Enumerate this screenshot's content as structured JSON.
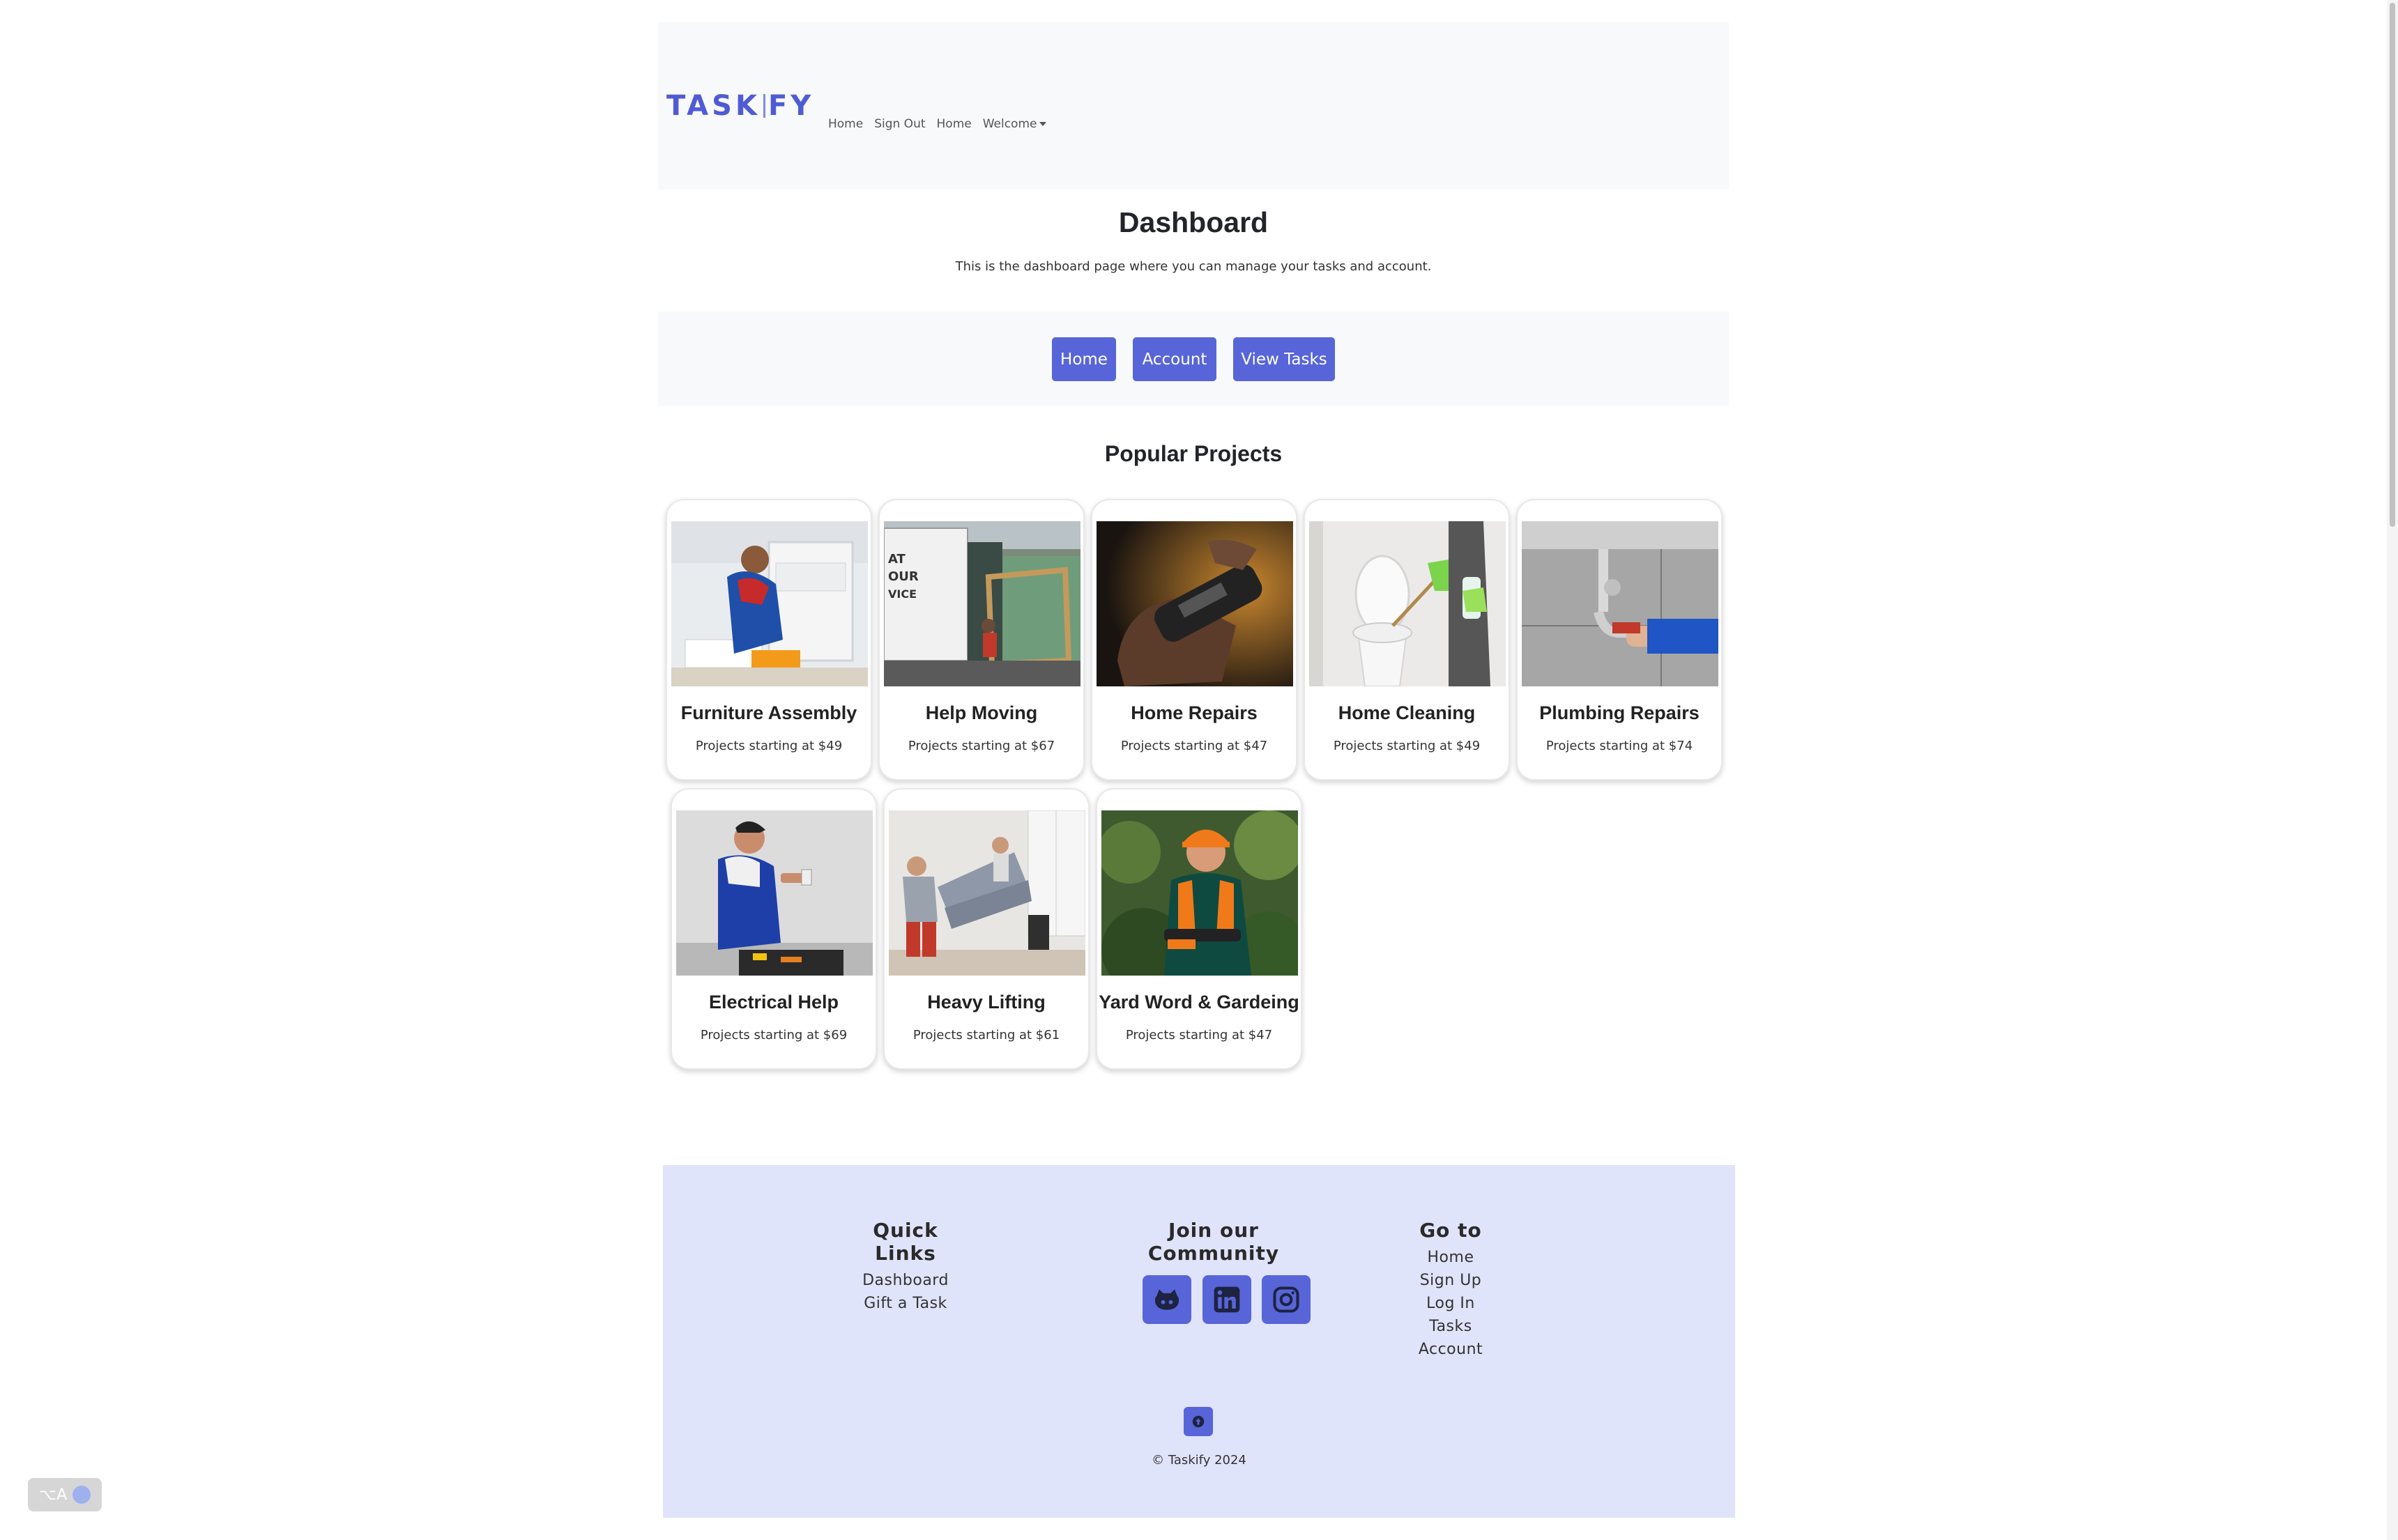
{
  "navbar": {
    "brand_left": "TASK",
    "brand_right": "FY",
    "links": [
      "Home",
      "Sign Out",
      "Home"
    ],
    "dropdown_label": "Welcome"
  },
  "header": {
    "title": "Dashboard",
    "subtitle": "This is the dashboard page where you can manage your tasks and account."
  },
  "actions": {
    "home": "Home",
    "account": "Account",
    "view_tasks": "View Tasks"
  },
  "popular": {
    "title": "Popular Projects",
    "cards": [
      {
        "title": "Furniture Assembly",
        "price": "Projects starting at $49"
      },
      {
        "title": "Help Moving",
        "price": "Projects starting at $67"
      },
      {
        "title": "Home Repairs",
        "price": "Projects starting at $47"
      },
      {
        "title": "Home Cleaning",
        "price": "Projects starting at $49"
      },
      {
        "title": "Plumbing Repairs",
        "price": "Projects starting at $74"
      },
      {
        "title": "Electrical Help",
        "price": "Projects starting at $69"
      },
      {
        "title": "Heavy Lifting",
        "price": "Projects starting at $61"
      },
      {
        "title": "Yard Word & Gardeing",
        "price": "Projects starting at $47"
      }
    ]
  },
  "footer": {
    "quick_links": {
      "title": "Quick Links",
      "items": [
        "Dashboard",
        "Gift a Task"
      ]
    },
    "community": {
      "title": "Join our Community",
      "icons": [
        "github-icon",
        "linkedin-icon",
        "instagram-icon"
      ]
    },
    "goto": {
      "title": "Go to",
      "items": [
        "Home",
        "Sign Up",
        "Log In",
        "Tasks",
        "Account"
      ]
    },
    "copyright": "© Taskify 2024"
  },
  "colors": {
    "accent": "#5865d8",
    "footer_bg": "#e0e4fa",
    "nav_bg": "#f8f9fa"
  },
  "lang_widget": {
    "label": "⌥A"
  }
}
